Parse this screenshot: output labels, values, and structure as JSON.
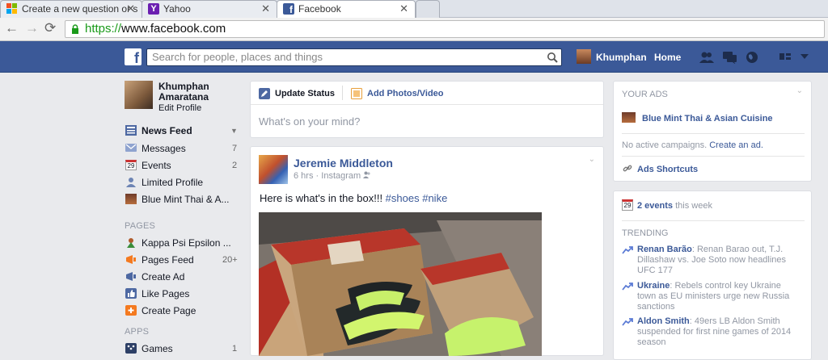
{
  "browser": {
    "tabs": [
      {
        "title": "Create a new question or s"
      },
      {
        "title": "Yahoo"
      },
      {
        "title": "Facebook"
      }
    ],
    "url_scheme": "https://",
    "url_host": "www.facebook.com"
  },
  "header": {
    "search_placeholder": "Search for people, places and things",
    "user_name": "Khumphan",
    "home": "Home"
  },
  "profile": {
    "name_line1": "Khumphan",
    "name_line2": "Amaratana",
    "edit": "Edit Profile"
  },
  "nav": {
    "favorites": [
      {
        "label": "News Feed",
        "count": ""
      },
      {
        "label": "Messages",
        "count": "7"
      },
      {
        "label": "Events",
        "count": "2"
      },
      {
        "label": "Limited Profile",
        "count": ""
      },
      {
        "label": "Blue Mint Thai & A...",
        "count": ""
      }
    ],
    "pages_header": "PAGES",
    "pages": [
      {
        "label": "Kappa Psi Epsilon ...",
        "count": ""
      },
      {
        "label": "Pages Feed",
        "count": "20+"
      },
      {
        "label": "Create Ad",
        "count": ""
      },
      {
        "label": "Like Pages",
        "count": ""
      },
      {
        "label": "Create Page",
        "count": ""
      }
    ],
    "apps_header": "APPS",
    "apps": [
      {
        "label": "Games",
        "count": "1"
      }
    ],
    "events_day": "29"
  },
  "composer": {
    "update_status": "Update Status",
    "add_photos": "Add Photos/Video",
    "placeholder": "What's on your mind?"
  },
  "post": {
    "author": "Jeremie Middleton",
    "time": "6 hrs",
    "separator": "·",
    "via": "Instagram",
    "text": "Here is what's in the box!!! ",
    "hashtag1": "#shoes",
    "hashtag2": "#nike"
  },
  "right": {
    "your_ads": "YOUR ADS",
    "ad_page": "Blue Mint Thai & Asian Cuisine",
    "no_campaigns": "No active campaigns.",
    "create_ad": "Create an ad.",
    "ads_shortcuts": "Ads Shortcuts",
    "events_count": "2 events",
    "events_suffix": " this week",
    "events_day": "29",
    "trending_header": "TRENDING",
    "trending": [
      {
        "title": "Renan Barão",
        "text": ": Renan Barao out, T.J. Dillashaw vs. Joe Soto now headlines UFC 177"
      },
      {
        "title": "Ukraine",
        "text": ": Rebels control key Ukraine town as EU ministers urge new Russia sanctions"
      },
      {
        "title": "Aldon Smith",
        "text": ": 49ers LB Aldon Smith suspended for first nine games of 2014 season"
      }
    ]
  },
  "colors": {
    "fb_blue": "#3b5998",
    "link_blue": "#3b5998",
    "page_bg": "#e9eaed",
    "url_green": "#1a9a1a"
  }
}
